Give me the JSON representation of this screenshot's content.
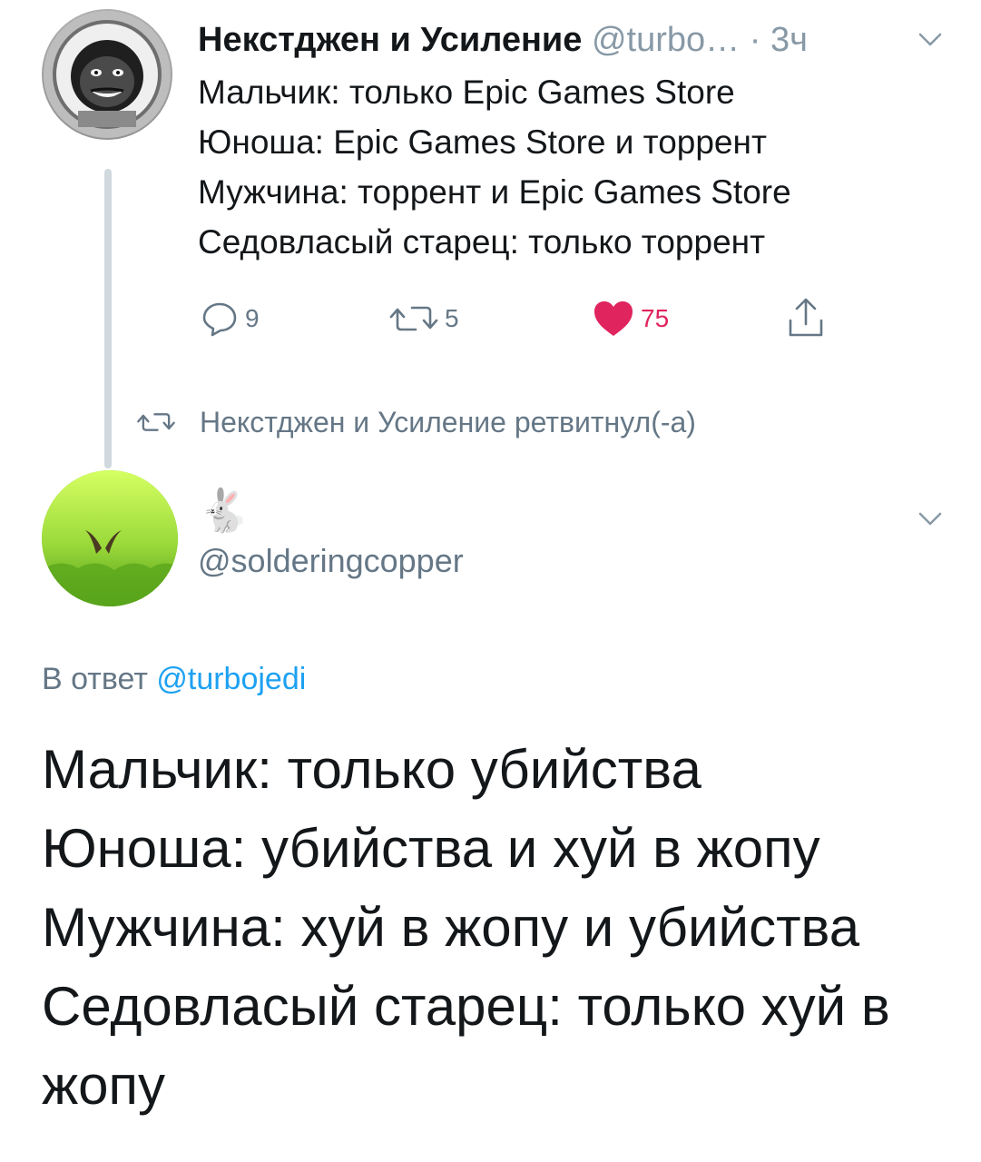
{
  "tweet1": {
    "display_name": "Некстджен и Усиление",
    "handle": "@turbo…",
    "separator": "·",
    "time": "3ч",
    "lines": [
      "Мальчик: только Epic Games Store",
      "Юноша: Epic Games Store и торрент",
      "Мужчина: торрент и Epic Games Store",
      "Седовласый старец: только торрент"
    ],
    "actions": {
      "replies": "9",
      "retweets": "5",
      "likes": "75"
    },
    "icons": {
      "reply": "reply-icon",
      "retweet": "retweet-icon",
      "like": "heart-icon",
      "share": "share-icon",
      "menu": "chevron-down-icon"
    }
  },
  "retweet_notice": {
    "label": "Некстджен и Усиление ретвитнул(-а)",
    "icon": "retweet-icon"
  },
  "tweet2": {
    "display_name": "🐇",
    "handle": "@solderingcopper",
    "reply_prefix": "В ответ",
    "reply_mention": "@turbojedi",
    "lines": [
      "Мальчик: только убийства",
      "Юноша: убийства и хуй в жопу",
      "Мужчина: хуй в жопу и убийства",
      "Седовласый старец: только хуй в жопу"
    ]
  },
  "colors": {
    "text": "#14171a",
    "secondary": "#657786",
    "accent_blue": "#1da1f2",
    "like_red": "#e0245e",
    "thread_line": "#cfd9de"
  }
}
